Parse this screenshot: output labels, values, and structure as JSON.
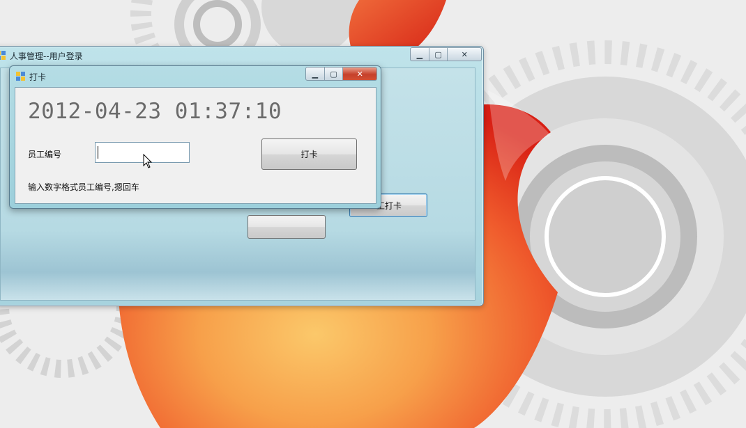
{
  "colors": {
    "apple_red": "#e8321e",
    "apple_orange": "#f7a04a",
    "window_frame": "#a7d3de",
    "datetime_text": "#6b6b6b"
  },
  "parent_window": {
    "title": "人事管理--用户登录",
    "icon": "app-icon",
    "controls": [
      "minimize-icon",
      "maximize-icon",
      "close-icon"
    ],
    "visible_button_label": "工打卡"
  },
  "punch_dialog": {
    "title": "打卡",
    "icon": "app-icon",
    "controls": [
      "minimize-icon",
      "maximize-icon",
      "close-icon"
    ],
    "datetime": "2012-04-23 01:37:10",
    "employee_id_label": "员工编号",
    "employee_id_value": "",
    "punch_button_label": "打卡",
    "hint": "输入数字格式员工编号,摁回车"
  }
}
